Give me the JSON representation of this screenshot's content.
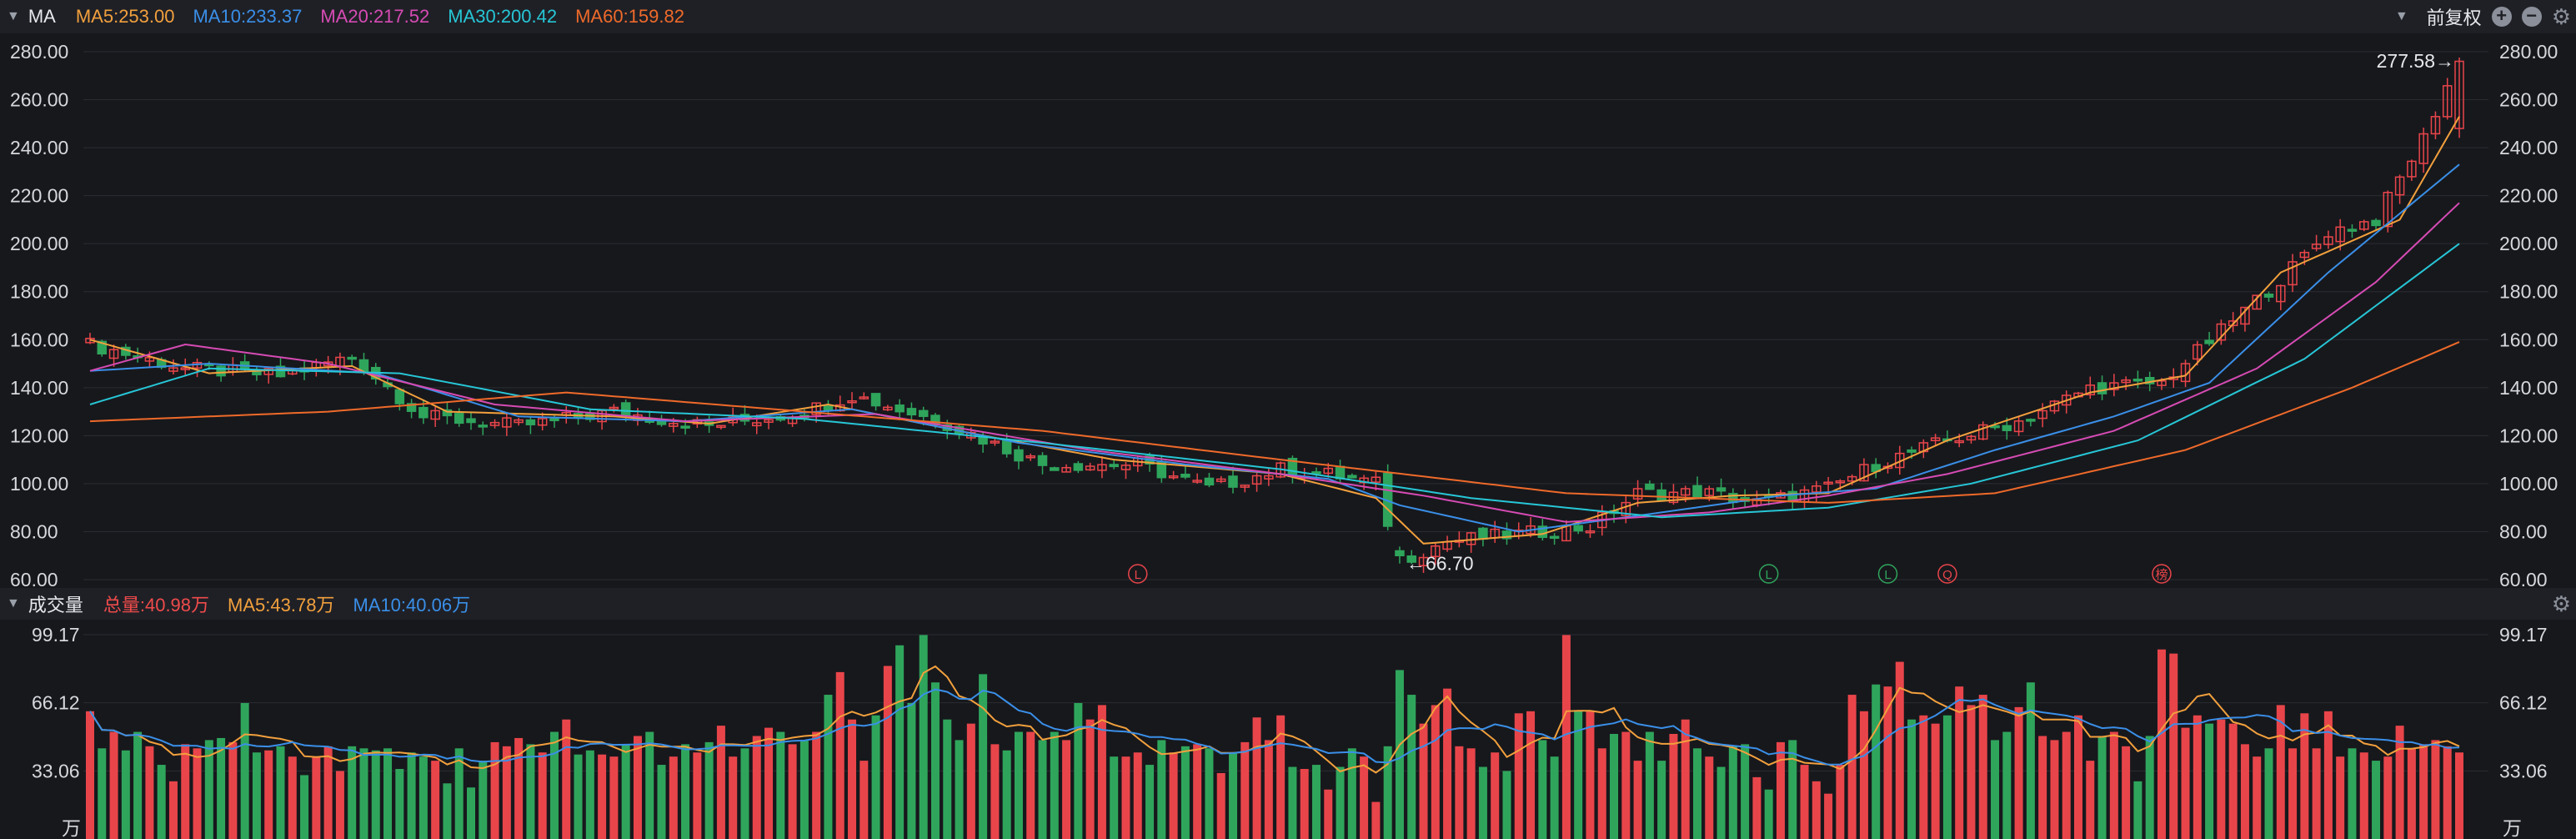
{
  "header": {
    "indicator": "MA",
    "legend": [
      {
        "text": "MA5:253.00",
        "color": "#f2a03d"
      },
      {
        "text": "MA10:233.37",
        "color": "#3a8fe8"
      },
      {
        "text": "MA20:217.52",
        "color": "#d64bb4"
      },
      {
        "text": "MA30:200.42",
        "color": "#27c6d6"
      },
      {
        "text": "MA60:159.82",
        "color": "#ef6a2a"
      }
    ],
    "adjust_label": "前复权"
  },
  "volume_header": {
    "indicator": "成交量",
    "legend": [
      {
        "text": "总量:40.98万",
        "color": "#ef4b4b"
      },
      {
        "text": "MA5:43.78万",
        "color": "#f2a03d"
      },
      {
        "text": "MA10:40.06万",
        "color": "#3a8fe8"
      }
    ]
  },
  "colors": {
    "up": "#e8454a",
    "down": "#2fa55c",
    "grid": "#2a2c33",
    "axis_text": "#d6d8dd"
  },
  "chart_data": [
    {
      "type": "candlestick",
      "y_ticks": [
        "280.00",
        "260.00",
        "240.00",
        "220.00",
        "200.00",
        "180.00",
        "160.00",
        "140.00",
        "120.00",
        "100.00",
        "80.00",
        "60.00"
      ],
      "ylim": [
        60,
        280
      ],
      "annotations": [
        {
          "text": "277.58→",
          "price": 277.58,
          "index": 199,
          "kind": "high"
        },
        {
          "text": "←66.70",
          "price": 66.7,
          "index": 110,
          "kind": "low"
        }
      ],
      "markers": [
        {
          "text": "L",
          "index": 88,
          "color": "#e8454a"
        },
        {
          "text": "L",
          "index": 141,
          "color": "#2fa55c"
        },
        {
          "text": "L",
          "index": 151,
          "color": "#2fa55c"
        },
        {
          "text": "Q",
          "index": 156,
          "color": "#e8454a"
        },
        {
          "text": "榜",
          "index": 174,
          "color": "#e8454a"
        }
      ],
      "close_anchors": [
        [
          0,
          158
        ],
        [
          8,
          148
        ],
        [
          16,
          145
        ],
        [
          22,
          153
        ],
        [
          28,
          128
        ],
        [
          36,
          124
        ],
        [
          44,
          130
        ],
        [
          52,
          124
        ],
        [
          60,
          130
        ],
        [
          64,
          137
        ],
        [
          72,
          125
        ],
        [
          80,
          108
        ],
        [
          88,
          108
        ],
        [
          94,
          98
        ],
        [
          100,
          106
        ],
        [
          104,
          104
        ],
        [
          108,
          100
        ],
        [
          110,
          68
        ],
        [
          114,
          76
        ],
        [
          120,
          79
        ],
        [
          126,
          82
        ],
        [
          130,
          96
        ],
        [
          136,
          96
        ],
        [
          140,
          92
        ],
        [
          146,
          98
        ],
        [
          150,
          108
        ],
        [
          156,
          118
        ],
        [
          162,
          126
        ],
        [
          168,
          140
        ],
        [
          174,
          142
        ],
        [
          180,
          168
        ],
        [
          184,
          185
        ],
        [
          188,
          205
        ],
        [
          192,
          210
        ],
        [
          196,
          244
        ],
        [
          199,
          277
        ]
      ],
      "ma": [
        {
          "name": "MA5",
          "color": "#f2a03d",
          "points": [
            [
              0,
              160
            ],
            [
              10,
              146
            ],
            [
              22,
              149
            ],
            [
              30,
              130
            ],
            [
              44,
              128
            ],
            [
              52,
              125
            ],
            [
              62,
              133
            ],
            [
              74,
              121
            ],
            [
              86,
              110
            ],
            [
              100,
              104
            ],
            [
              108,
              94
            ],
            [
              112,
              75
            ],
            [
              122,
              79
            ],
            [
              130,
              92
            ],
            [
              138,
              95
            ],
            [
              146,
              96
            ],
            [
              156,
              118
            ],
            [
              168,
              138
            ],
            [
              176,
              145
            ],
            [
              184,
              188
            ],
            [
              194,
              210
            ],
            [
              199,
              253
            ]
          ]
        },
        {
          "name": "MA10",
          "color": "#3a8fe8",
          "points": [
            [
              0,
              147
            ],
            [
              10,
              150
            ],
            [
              24,
              146
            ],
            [
              36,
              128
            ],
            [
              50,
              126
            ],
            [
              64,
              131
            ],
            [
              78,
              117
            ],
            [
              92,
              108
            ],
            [
              104,
              102
            ],
            [
              110,
              91
            ],
            [
              120,
              80
            ],
            [
              132,
              88
            ],
            [
              142,
              95
            ],
            [
              150,
              98
            ],
            [
              160,
              114
            ],
            [
              170,
              128
            ],
            [
              178,
              142
            ],
            [
              188,
              188
            ],
            [
              199,
              233
            ]
          ]
        },
        {
          "name": "MA20",
          "color": "#d64bb4",
          "points": [
            [
              0,
              147
            ],
            [
              8,
              158
            ],
            [
              20,
              150
            ],
            [
              34,
              133
            ],
            [
              50,
              126
            ],
            [
              66,
              129
            ],
            [
              84,
              114
            ],
            [
              100,
              104
            ],
            [
              112,
              95
            ],
            [
              124,
              84
            ],
            [
              136,
              88
            ],
            [
              146,
              95
            ],
            [
              156,
              104
            ],
            [
              170,
              122
            ],
            [
              182,
              148
            ],
            [
              192,
              184
            ],
            [
              199,
              217
            ]
          ]
        },
        {
          "name": "MA30",
          "color": "#27c6d6",
          "points": [
            [
              0,
              133
            ],
            [
              10,
              148
            ],
            [
              26,
              146
            ],
            [
              42,
              131
            ],
            [
              60,
              127
            ],
            [
              80,
              117
            ],
            [
              100,
              106
            ],
            [
              116,
              94
            ],
            [
              132,
              86
            ],
            [
              146,
              90
            ],
            [
              158,
              100
            ],
            [
              172,
              118
            ],
            [
              186,
              152
            ],
            [
              199,
              200
            ]
          ]
        },
        {
          "name": "MA60",
          "color": "#ef6a2a",
          "points": [
            [
              0,
              126
            ],
            [
              20,
              130
            ],
            [
              40,
              138
            ],
            [
              60,
              130
            ],
            [
              80,
              122
            ],
            [
              100,
              110
            ],
            [
              124,
              96
            ],
            [
              146,
              92
            ],
            [
              160,
              96
            ],
            [
              176,
              114
            ],
            [
              190,
              140
            ],
            [
              199,
              159
            ]
          ]
        }
      ]
    },
    {
      "type": "bar",
      "name": "volume",
      "unit": "万",
      "y_ticks": [
        "99.17",
        "66.12",
        "33.06"
      ],
      "ylim": [
        0,
        99.17
      ],
      "volumes": [
        62,
        44,
        52,
        43,
        52,
        45,
        36,
        28,
        46,
        44,
        48,
        49,
        47,
        66,
        42,
        43,
        45,
        40,
        31,
        40,
        45,
        33,
        45,
        44,
        43,
        44,
        34,
        42,
        40,
        38,
        27,
        44,
        25,
        38,
        47,
        45,
        49,
        46,
        42,
        52,
        58,
        41,
        43,
        41,
        40,
        46,
        50,
        52,
        36,
        40,
        46,
        42,
        47,
        55,
        40,
        44,
        50,
        54,
        52,
        46,
        48,
        52,
        70,
        81,
        58,
        38,
        60,
        84,
        94,
        66,
        99,
        76,
        58,
        48,
        56,
        80,
        46,
        43,
        52,
        52,
        48,
        52,
        48,
        66,
        58,
        65,
        40,
        40,
        42,
        36,
        48,
        42,
        45,
        46,
        44,
        32,
        42,
        47,
        59,
        48,
        60,
        35,
        34,
        36,
        24,
        35,
        44,
        40,
        18,
        45,
        82,
        70,
        56,
        65,
        73,
        45,
        44,
        35,
        42,
        33,
        61,
        62,
        48,
        40,
        99,
        62,
        62,
        44,
        51,
        52,
        38,
        52,
        38,
        51,
        58,
        44,
        40,
        35,
        45,
        46,
        30,
        24,
        47,
        48,
        36,
        28,
        22,
        36,
        70,
        62,
        75,
        74,
        86,
        58,
        60,
        56,
        60,
        74,
        65,
        70,
        48,
        52,
        64,
        76,
        50,
        48,
        52,
        60,
        38,
        50,
        52,
        45,
        28,
        50,
        92,
        90,
        54,
        60,
        56,
        58,
        56,
        46,
        40,
        44,
        65,
        44,
        61,
        44,
        62,
        40,
        44,
        42,
        38,
        40,
        55,
        44,
        46,
        48,
        45,
        42
      ]
    }
  ]
}
